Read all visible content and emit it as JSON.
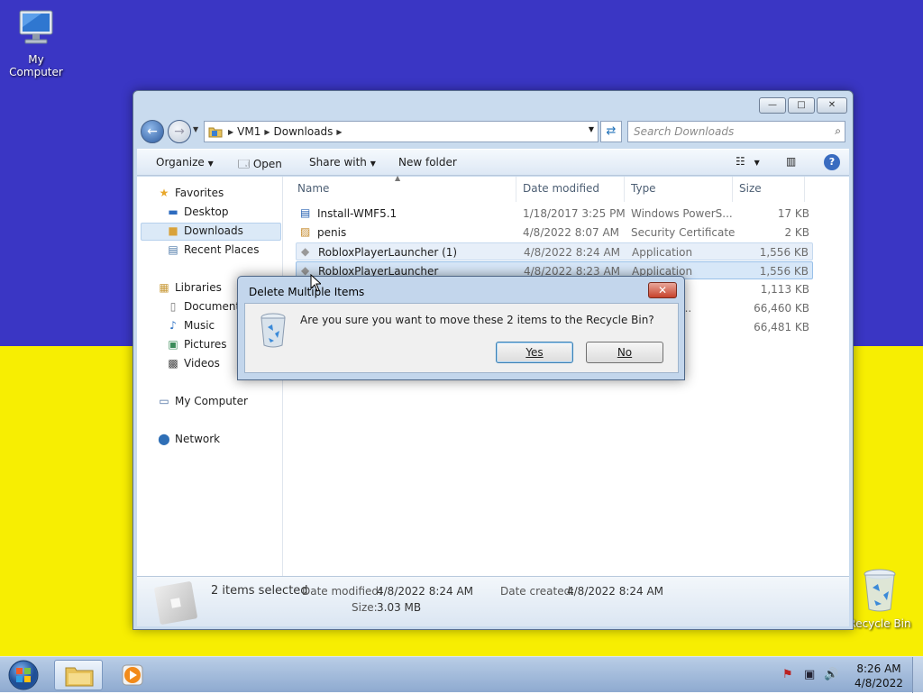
{
  "desktop": {
    "icons": [
      {
        "label": "My Computer",
        "icon": "computer-icon"
      },
      {
        "label": "Recycle Bin",
        "icon": "recycle-bin-icon"
      }
    ]
  },
  "explorer": {
    "address": {
      "root": "VM1",
      "folder": "Downloads"
    },
    "search_placeholder": "Search Downloads",
    "toolbar": {
      "organize": "Organize",
      "open": "Open",
      "share_with": "Share with",
      "new_folder": "New folder"
    },
    "nav": {
      "favorites": "Favorites",
      "desktop": "Desktop",
      "downloads": "Downloads",
      "recent_places": "Recent Places",
      "libraries": "Libraries",
      "documents": "Documents",
      "music": "Music",
      "pictures": "Pictures",
      "videos": "Videos",
      "my_computer": "My Computer",
      "network": "Network"
    },
    "columns": {
      "name": "Name",
      "date": "Date modified",
      "type": "Type",
      "size": "Size"
    },
    "files": [
      {
        "name": "Install-WMF5.1",
        "date": "1/18/2017 3:25 PM",
        "type": "Windows PowerS...",
        "size": "17 KB",
        "icon": "powershell-script-icon"
      },
      {
        "name": "penis",
        "date": "4/8/2022 8:07 AM",
        "type": "Security Certificate",
        "size": "2 KB",
        "icon": "certificate-icon"
      },
      {
        "name": "RobloxPlayerLauncher (1)",
        "date": "4/8/2022 8:24 AM",
        "type": "Application",
        "size": "1,556 KB",
        "icon": "roblox-icon"
      },
      {
        "name": "RobloxPlayerLauncher",
        "date": "4/8/2022 8:23 AM",
        "type": "Application",
        "size": "1,556 KB",
        "icon": "roblox-icon"
      },
      {
        "name": "",
        "date": "",
        "type": "ve",
        "size": "1,113 KB"
      },
      {
        "name": "",
        "date": "",
        "type": "t Update ...",
        "size": "66,460 KB"
      },
      {
        "name": "",
        "date": "",
        "type": "ve",
        "size": "66,481 KB"
      }
    ],
    "details": {
      "selection": "2 items selected",
      "date_modified_label": "Date modified:",
      "date_modified": "4/8/2022 8:24 AM",
      "date_created_label": "Date created:",
      "date_created": "4/8/2022 8:24 AM",
      "size_label": "Size:",
      "size": "3.03 MB"
    }
  },
  "dialog": {
    "title": "Delete Multiple Items",
    "message": "Are you sure you want to move these 2 items to the Recycle Bin?",
    "yes": "Yes",
    "no": "No"
  },
  "taskbar": {
    "time": "8:26 AM",
    "date": "4/8/2022"
  }
}
